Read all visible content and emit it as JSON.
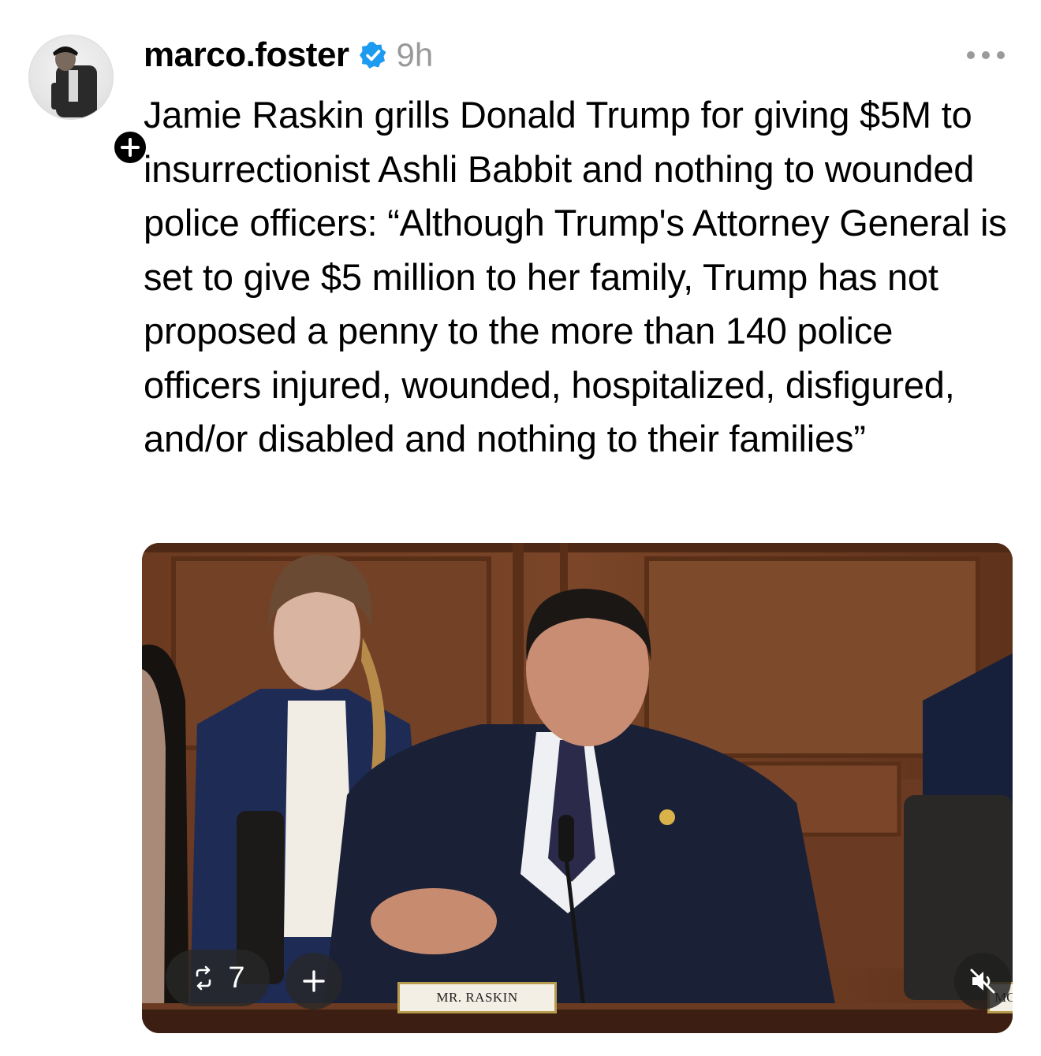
{
  "post": {
    "username": "marco.foster",
    "verified": true,
    "time": "9h",
    "text": "Jamie Raskin grills Donald Trump for giving $5M to insurrectionist Ashli Babbit and nothing to wounded police officers: “Although Trump's Attorney General is set to give $5 million to her family, Trump has not proposed a penny to the more than 140 police officers injured, wounded, hospitalized, disfigured, and/or disabled and nothing to their families”"
  },
  "media": {
    "nameplate_main": "MR. RASKIN",
    "nameplate_side": "MO",
    "repost_count": "7"
  },
  "icons": {
    "avatar": "avatar-icon",
    "follow": "plus-icon",
    "verified": "verified-badge-icon",
    "more": "more-horizontal-icon",
    "repost": "repost-icon",
    "add": "plus-icon",
    "mute": "speaker-muted-icon"
  },
  "colors": {
    "verified_blue": "#1d9bf0",
    "time_gray": "#999999",
    "overlay_dark": "#282828"
  }
}
